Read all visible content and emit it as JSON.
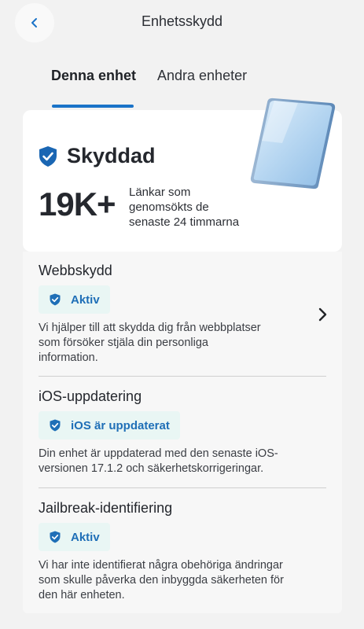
{
  "header": {
    "title": "Enhetsskydd",
    "back_icon": "chevron-left-icon"
  },
  "tabs": [
    {
      "label": "Denna enhet",
      "active": true
    },
    {
      "label": "Andra enheter",
      "active": false
    }
  ],
  "status": {
    "title": "Skyddad",
    "icon": "shield-check-icon",
    "image": "phone-illustration",
    "stat_value": "19K+",
    "stat_lines": [
      "Länkar som",
      "genomsökts de",
      "senaste 24 timmarna"
    ]
  },
  "items": [
    {
      "title": "Webbskydd",
      "badge": "Aktiv",
      "desc_lines": [
        "Vi hjälper till att skydda dig från webbplatser",
        "som försöker stjäla din personliga",
        "information."
      ]
    },
    {
      "title": "iOS-uppdatering",
      "badge": "iOS är uppdaterat",
      "desc_lines": [
        "Din enhet är uppdaterad med den senaste iOS-",
        "versionen 17.1.2 och säkerhetskorrigeringar."
      ]
    },
    {
      "title": "Jailbreak-identifiering",
      "badge": "Aktiv",
      "desc_lines": [
        "Vi har inte identifierat några obehöriga ändringar",
        "som skulle påverka den inbyggda säkerheten för",
        "den här enheten."
      ]
    }
  ],
  "colors": {
    "accent": "#1a73c8",
    "badge_bg": "#e9f6f4",
    "badge_text": "#1f6fb7",
    "background": "#f2f2f2"
  }
}
